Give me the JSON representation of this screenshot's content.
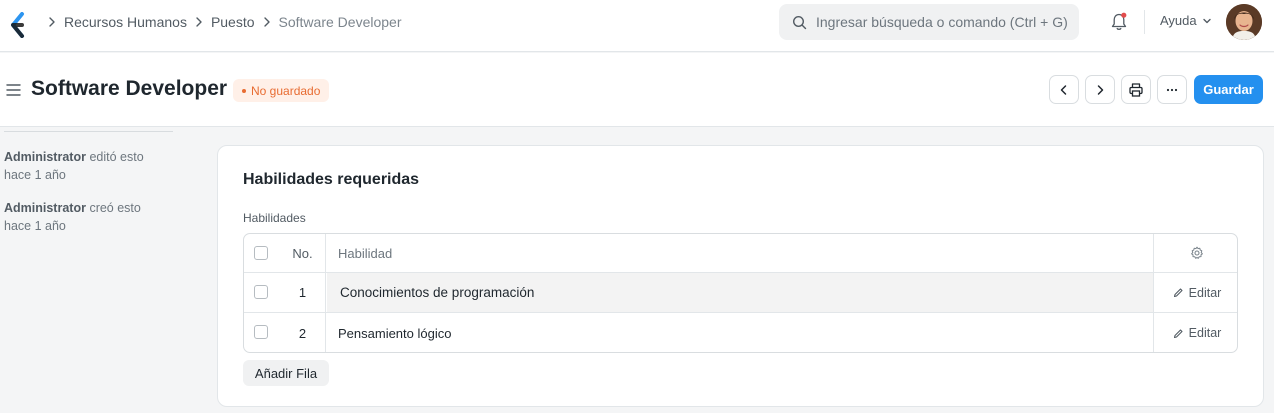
{
  "navbar": {
    "logo_icon": "app-logo-chevron",
    "breadcrumbs": [
      "Recursos Humanos",
      "Puesto",
      "Software Developer"
    ],
    "search": {
      "placeholder": "Ingresar búsqueda o comando (Ctrl + G)"
    },
    "help_label": "Ayuda"
  },
  "page": {
    "title": "Software Developer",
    "indicator": "No guardado",
    "save_label": "Guardar",
    "indicator_color": "#e86c32",
    "primary_color": "#2490ef"
  },
  "timeline": [
    {
      "user": "Administrator",
      "action": "editó esto",
      "time": "hace 1 año"
    },
    {
      "user": "Administrator",
      "action": "creó esto",
      "time": "hace 1 año"
    }
  ],
  "section": {
    "title": "Habilidades requeridas",
    "field_label": "Habilidades",
    "columns": {
      "no": "No.",
      "skill": "Habilidad"
    },
    "rows": [
      {
        "no": "1",
        "skill": "Conocimientos de programación",
        "action": "Editar"
      },
      {
        "no": "2",
        "skill": "Pensamiento lógico",
        "action": "Editar"
      }
    ],
    "add_row_label": "Añadir Fila"
  }
}
